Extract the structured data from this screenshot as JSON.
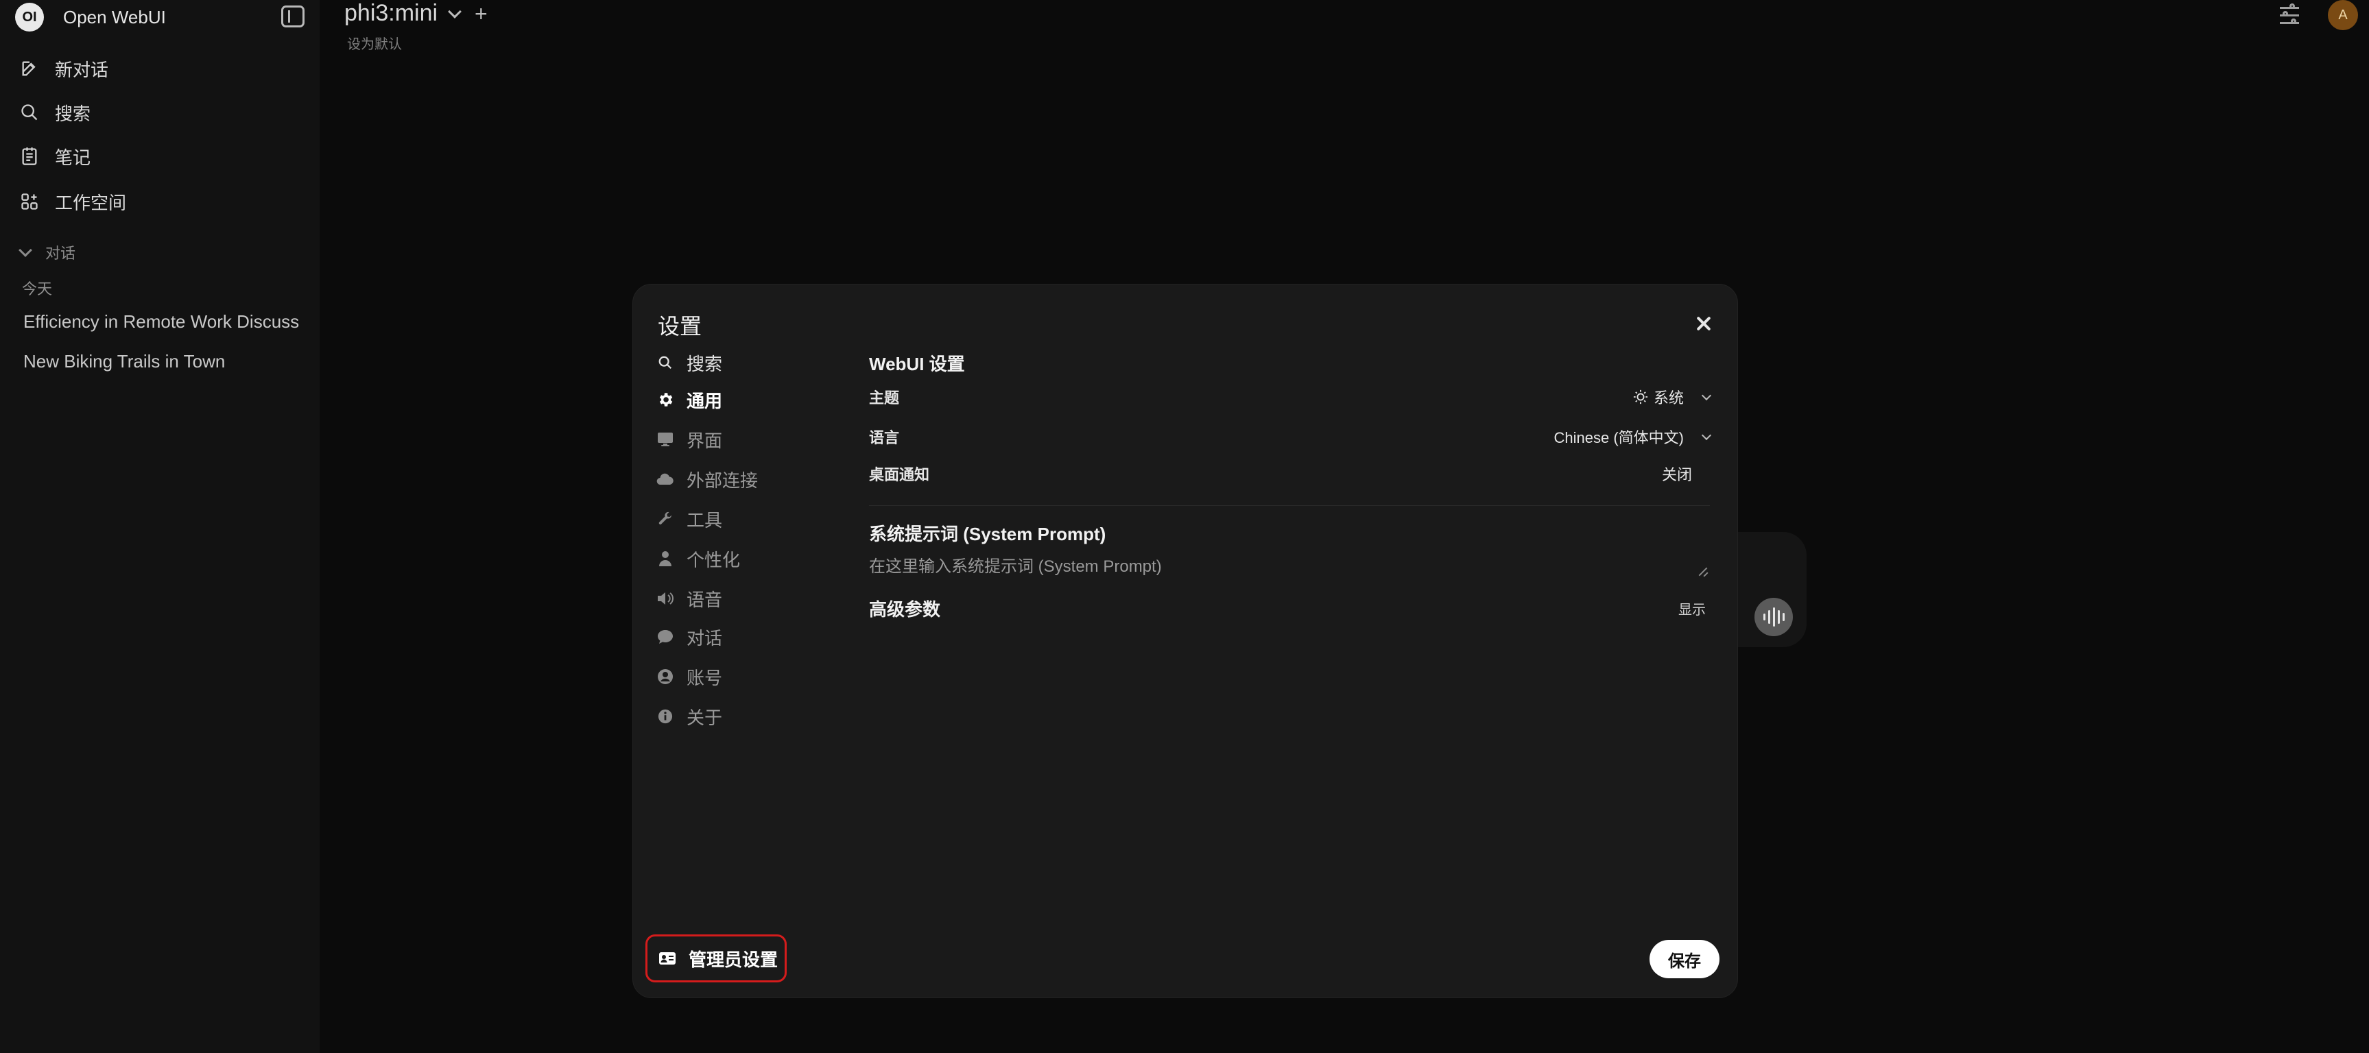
{
  "app": {
    "brand_name": "Open WebUI",
    "logo_text": "OI"
  },
  "sidebar": {
    "items": [
      {
        "label": "新对话",
        "icon": "pencil-square-icon"
      },
      {
        "label": "搜索",
        "icon": "search-icon"
      },
      {
        "label": "笔记",
        "icon": "note-icon"
      },
      {
        "label": "工作空间",
        "icon": "workspace-icon"
      }
    ],
    "section_label": "对话",
    "group_today": "今天",
    "chats": [
      "Efficiency in Remote Work Discuss",
      "New Biking Trails in Town"
    ]
  },
  "topbar": {
    "model_name": "phi3:mini",
    "add_symbol": "+",
    "set_default": "设为默认",
    "avatar_letter": "A"
  },
  "settings": {
    "title": "设置",
    "tabs": [
      {
        "label": "搜索",
        "icon": "search-icon"
      },
      {
        "label": "通用",
        "icon": "gear-icon"
      },
      {
        "label": "界面",
        "icon": "monitor-icon"
      },
      {
        "label": "外部连接",
        "icon": "cloud-icon"
      },
      {
        "label": "工具",
        "icon": "wrench-icon"
      },
      {
        "label": "个性化",
        "icon": "user-icon"
      },
      {
        "label": "语音",
        "icon": "speaker-icon"
      },
      {
        "label": "对话",
        "icon": "chat-bubble-icon"
      },
      {
        "label": "账号",
        "icon": "account-icon"
      },
      {
        "label": "关于",
        "icon": "info-icon"
      }
    ],
    "active_tab": "通用",
    "webui_title": "WebUI 设置",
    "theme_label": "主题",
    "theme_value": "系统",
    "language_label": "语言",
    "language_value": "Chinese (简体中文)",
    "notification_label": "桌面通知",
    "notification_value": "关闭",
    "system_prompt_title": "系统提示词 (System Prompt)",
    "system_prompt_placeholder": "在这里输入系统提示词 (System Prompt)",
    "advanced_title": "高级参数",
    "advanced_toggle": "显示",
    "admin_button": "管理员设置",
    "save_button": "保存"
  }
}
